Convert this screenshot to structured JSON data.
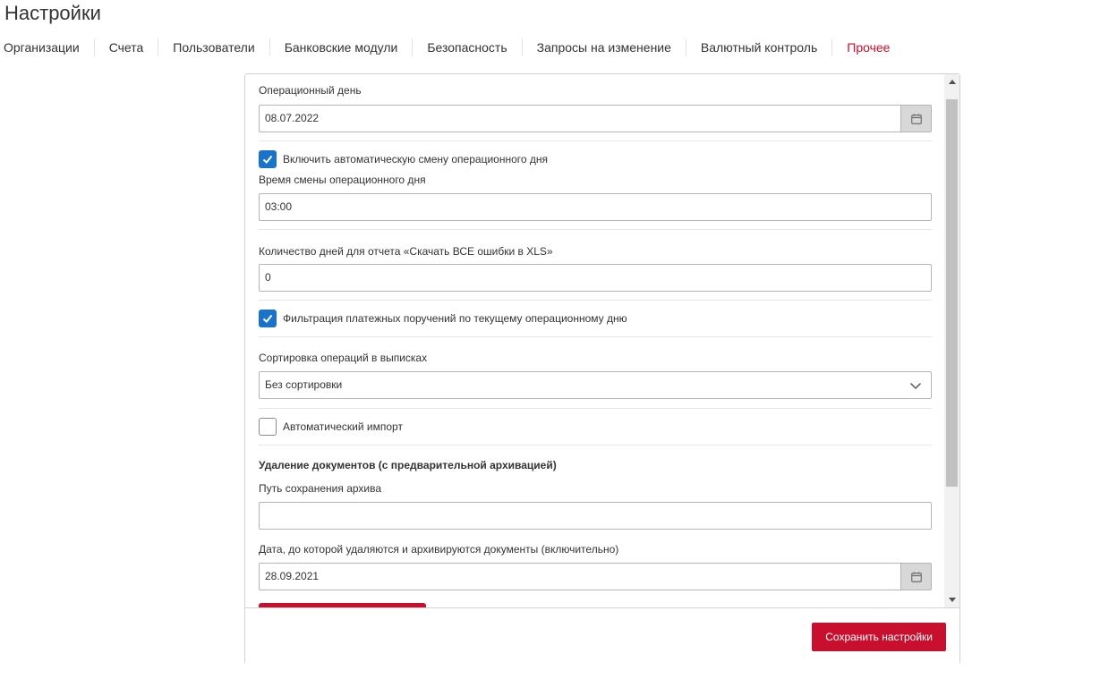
{
  "page": {
    "title": "Настройки"
  },
  "tabs": [
    {
      "label": "Организации",
      "active": false
    },
    {
      "label": "Счета",
      "active": false
    },
    {
      "label": "Пользователи",
      "active": false
    },
    {
      "label": "Банковские модули",
      "active": false
    },
    {
      "label": "Безопасность",
      "active": false
    },
    {
      "label": "Запросы на изменение",
      "active": false
    },
    {
      "label": "Валютный контроль",
      "active": false
    },
    {
      "label": "Прочее",
      "active": true
    }
  ],
  "form": {
    "operational_day": {
      "label": "Операционный день",
      "value": "08.07.2022",
      "icon": "calendar-icon"
    },
    "auto_change": {
      "label": "Включить автоматическую смену операционного дня",
      "checked": true
    },
    "change_time": {
      "label": "Время смены операционного дня",
      "value": "03:00"
    },
    "days_count": {
      "label": "Количество дней для отчета «Скачать ВСЕ ошибки в XLS»",
      "value": "0"
    },
    "filter_payments": {
      "label": "Фильтрация платежных поручений по текущему операционному дню",
      "checked": true
    },
    "sorting": {
      "label": "Сортировка операций в выписках",
      "value": "Без сортировки",
      "icon": "chevron-down-icon"
    },
    "auto_import": {
      "label": "Автоматический импорт",
      "checked": false
    },
    "deletion": {
      "heading": "Удаление документов (с предварительной архивацией)",
      "archive_path": {
        "label": "Путь сохранения архива",
        "value": ""
      },
      "date_until": {
        "label": "Дата, до которой удаляются и архивируются документы (включительно)",
        "value": "28.09.2021",
        "icon": "calendar-icon"
      }
    }
  },
  "footer": {
    "save_label": "Сохранить настройки"
  },
  "colors": {
    "accent": "#c8102e",
    "checkbox": "#1a73c9",
    "text": "#333333"
  }
}
